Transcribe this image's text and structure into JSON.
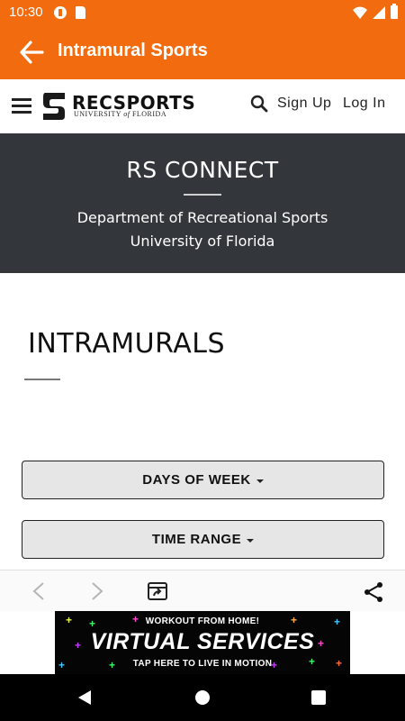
{
  "status_bar": {
    "time": "10:30",
    "icons": [
      "app-notification-icon",
      "sd-card-icon",
      "wifi-icon",
      "signal-icon",
      "battery-icon"
    ]
  },
  "app_bar": {
    "title": "Intramural Sports",
    "back_icon": "arrow-left-icon",
    "color": "#f26b0f"
  },
  "site_header": {
    "logo_text": "RECSPORTS",
    "logo_sub_prefix": "UNIVERSITY ",
    "logo_sub_of": "of",
    "logo_sub_suffix": " FLORIDA",
    "search_icon": "search-icon",
    "sign_up": "Sign Up",
    "log_in": "Log In"
  },
  "banner": {
    "title": "RS CONNECT",
    "line1": "Department of Recreational Sports",
    "line2": "University of Florida",
    "background": "#33373b"
  },
  "main": {
    "heading": "INTRAMURALS",
    "filters": [
      {
        "label": "DAYS OF WEEK"
      },
      {
        "label": "TIME RANGE"
      }
    ]
  },
  "browser_bar": {
    "icons": [
      "chevron-left-icon",
      "chevron-right-icon",
      "open-in-browser-icon",
      "share-icon"
    ]
  },
  "ad": {
    "top": "WORKOUT FROM HOME!",
    "main": "VIRTUAL SERVICES",
    "bottom": "TAP HERE TO LIVE IN MOTION"
  },
  "nav_bar": {
    "icons": [
      "back-triangle-icon",
      "home-circle-icon",
      "recents-square-icon"
    ]
  }
}
